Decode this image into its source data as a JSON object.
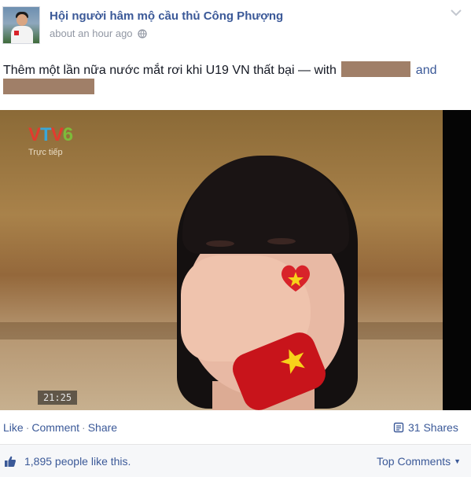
{
  "post": {
    "page_name": "Hội người hâm mộ cầu thủ Công Phượng",
    "timestamp": "about an hour ago",
    "privacy_icon": "globe-icon",
    "menu_icon": "chevron-down-icon",
    "message_text": "Thêm một lần nữa nước mắt rơi khi U19 VN thất bại — with",
    "message_and": "and"
  },
  "photo": {
    "logo_v1": "V",
    "logo_t": "T",
    "logo_v2": "V",
    "logo_6": "6",
    "live_label": "Trực tiếp",
    "timecode": "21:25"
  },
  "actions": {
    "like": "Like",
    "comment": "Comment",
    "share": "Share",
    "separator": "·",
    "shares_count": "31 Shares"
  },
  "likes": {
    "text": "1,895 people like this.",
    "top_comments": "Top Comments"
  },
  "colors": {
    "link": "#3b5998",
    "meta": "#9197a3",
    "redaction": "#a07f68"
  }
}
